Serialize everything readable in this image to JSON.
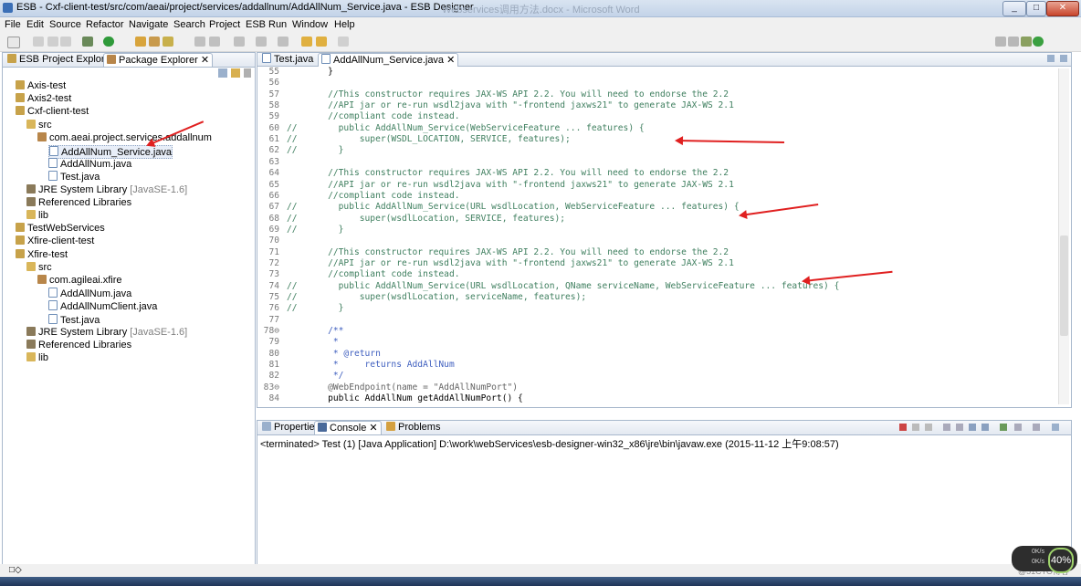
{
  "window": {
    "title": "ESB - Cxf-client-test/src/com/aeai/project/services/addallnum/AddAllNum_Service.java - ESB Designer",
    "ghost_title": "Webservices调用方法.docx - Microsoft Word",
    "buttons": {
      "minimize": "_",
      "maximize": "□",
      "close": "✕"
    }
  },
  "menu": [
    "File",
    "Edit",
    "Source",
    "Refactor",
    "Navigate",
    "Search",
    "Project",
    "ESB",
    "Run",
    "Window",
    "Help"
  ],
  "left_pane": {
    "tabs": [
      {
        "label": "ESB Project Explorer",
        "active": false
      },
      {
        "label": "Package Explorer",
        "active": true
      }
    ],
    "tree": [
      {
        "label": "Axis-test",
        "indent": 0,
        "icon": "project-icon"
      },
      {
        "label": "Axis2-test",
        "indent": 0,
        "icon": "project-icon"
      },
      {
        "label": "Cxf-client-test",
        "indent": 0,
        "icon": "project-icon"
      },
      {
        "label": "src",
        "indent": 1,
        "icon": "folder-icon"
      },
      {
        "label": "com.aeai.project.services.addallnum",
        "indent": 2,
        "icon": "package-icon"
      },
      {
        "label": "AddAllNum_Service.java",
        "indent": 3,
        "icon": "java-file-icon",
        "selected": true
      },
      {
        "label": "AddAllNum.java",
        "indent": 3,
        "icon": "java-file-icon"
      },
      {
        "label": "Test.java",
        "indent": 3,
        "icon": "java-file-icon"
      },
      {
        "label": "JRE System Library",
        "suffix": "[JavaSE-1.6]",
        "indent": 1,
        "icon": "library-icon"
      },
      {
        "label": "Referenced Libraries",
        "indent": 1,
        "icon": "library-icon"
      },
      {
        "label": "lib",
        "indent": 1,
        "icon": "folder-icon"
      },
      {
        "label": "TestWebServices",
        "indent": 0,
        "icon": "project-icon"
      },
      {
        "label": "Xfire-client-test",
        "indent": 0,
        "icon": "project-icon"
      },
      {
        "label": "Xfire-test",
        "indent": 0,
        "icon": "project-icon"
      },
      {
        "label": "src",
        "indent": 1,
        "icon": "folder-icon"
      },
      {
        "label": "com.agileai.xfire",
        "indent": 2,
        "icon": "package-icon"
      },
      {
        "label": "AddAllNum.java",
        "indent": 3,
        "icon": "java-file-icon"
      },
      {
        "label": "AddAllNumClient.java",
        "indent": 3,
        "icon": "java-file-icon"
      },
      {
        "label": "Test.java",
        "indent": 3,
        "icon": "java-file-icon"
      },
      {
        "label": "JRE System Library",
        "suffix": "[JavaSE-1.6]",
        "indent": 1,
        "icon": "library-icon"
      },
      {
        "label": "Referenced Libraries",
        "indent": 1,
        "icon": "library-icon"
      },
      {
        "label": "lib",
        "indent": 1,
        "icon": "folder-icon"
      }
    ]
  },
  "editor": {
    "tabs": [
      {
        "label": "Test.java",
        "active": false
      },
      {
        "label": "AddAllNum_Service.java",
        "active": true
      }
    ],
    "lines": [
      {
        "n": "55",
        "gutter": "",
        "text": "    }",
        "style": "plain"
      },
      {
        "n": "56",
        "gutter": "",
        "text": "",
        "style": "plain"
      },
      {
        "n": "57",
        "gutter": "",
        "text": "    //This constructor requires JAX-WS API 2.2. You will need to endorse the 2.2",
        "style": "cm"
      },
      {
        "n": "58",
        "gutter": "",
        "text": "    //API jar or re-run wsdl2java with \"-frontend jaxws21\" to generate JAX-WS 2.1",
        "style": "cm"
      },
      {
        "n": "59",
        "gutter": "",
        "text": "    //compliant code instead.",
        "style": "cm"
      },
      {
        "n": "60",
        "gutter": "//",
        "text": "      public AddAllNum_Service(WebServiceFeature ... features) {",
        "style": "cm"
      },
      {
        "n": "61",
        "gutter": "//",
        "text": "          super(WSDL_LOCATION, SERVICE, features);",
        "style": "cm"
      },
      {
        "n": "62",
        "gutter": "//",
        "text": "      }",
        "style": "cm"
      },
      {
        "n": "63",
        "gutter": "",
        "text": "",
        "style": "plain"
      },
      {
        "n": "64",
        "gutter": "",
        "text": "    //This constructor requires JAX-WS API 2.2. You will need to endorse the 2.2",
        "style": "cm"
      },
      {
        "n": "65",
        "gutter": "",
        "text": "    //API jar or re-run wsdl2java with \"-frontend jaxws21\" to generate JAX-WS 2.1",
        "style": "cm"
      },
      {
        "n": "66",
        "gutter": "",
        "text": "    //compliant code instead.",
        "style": "cm"
      },
      {
        "n": "67",
        "gutter": "//",
        "text": "      public AddAllNum_Service(URL wsdlLocation, WebServiceFeature ... features) {",
        "style": "cm"
      },
      {
        "n": "68",
        "gutter": "//",
        "text": "          super(wsdlLocation, SERVICE, features);",
        "style": "cm"
      },
      {
        "n": "69",
        "gutter": "//",
        "text": "      }",
        "style": "cm"
      },
      {
        "n": "70",
        "gutter": "",
        "text": "",
        "style": "plain"
      },
      {
        "n": "71",
        "gutter": "",
        "text": "    //This constructor requires JAX-WS API 2.2. You will need to endorse the 2.2",
        "style": "cm"
      },
      {
        "n": "72",
        "gutter": "",
        "text": "    //API jar or re-run wsdl2java with \"-frontend jaxws21\" to generate JAX-WS 2.1",
        "style": "cm"
      },
      {
        "n": "73",
        "gutter": "",
        "text": "    //compliant code instead.",
        "style": "cm"
      },
      {
        "n": "74",
        "gutter": "//",
        "text": "      public AddAllNum_Service(URL wsdlLocation, QName serviceName, WebServiceFeature ... features) {",
        "style": "cm"
      },
      {
        "n": "75",
        "gutter": "//",
        "text": "          super(wsdlLocation, serviceName, features);",
        "style": "cm"
      },
      {
        "n": "76",
        "gutter": "//",
        "text": "      }",
        "style": "cm"
      },
      {
        "n": "77",
        "gutter": "",
        "text": "",
        "style": "plain"
      },
      {
        "n": "78⊖",
        "gutter": "",
        "text": "    /**",
        "style": "jd"
      },
      {
        "n": "79",
        "gutter": "",
        "text": "     *",
        "style": "jd"
      },
      {
        "n": "80",
        "gutter": "",
        "text": "     * @return",
        "style": "jd"
      },
      {
        "n": "81",
        "gutter": "",
        "text": "     *     returns AddAllNum",
        "style": "jd"
      },
      {
        "n": "82",
        "gutter": "",
        "text": "     */",
        "style": "jd"
      },
      {
        "n": "83⊖",
        "gutter": "",
        "text": "    @WebEndpoint(name = \"AddAllNumPort\")",
        "style": "ann"
      },
      {
        "n": "84",
        "gutter": "",
        "text": "    public AddAllNum getAddAllNumPort() {",
        "style": "code"
      }
    ]
  },
  "console": {
    "tabs": [
      {
        "label": "Properties",
        "active": false
      },
      {
        "label": "Console",
        "active": true
      },
      {
        "label": "Problems",
        "active": false
      }
    ],
    "terminated": "<terminated> Test (1) [Java Application] D:\\work\\webServices\\esb-designer-win32_x86\\jre\\bin\\javaw.exe (2015-11-12 上午9:08:57)"
  },
  "status": {
    "left": "□◇"
  },
  "net_widget": {
    "percent": "40%",
    "up": "0K/s",
    "down": "0K/s"
  },
  "watermark": "@51CTO博客",
  "colors": {
    "comment": "#3f7f5f",
    "keyword": "#7f0055",
    "string": "#2a00ff",
    "annotation_arrow": "#e02020"
  }
}
